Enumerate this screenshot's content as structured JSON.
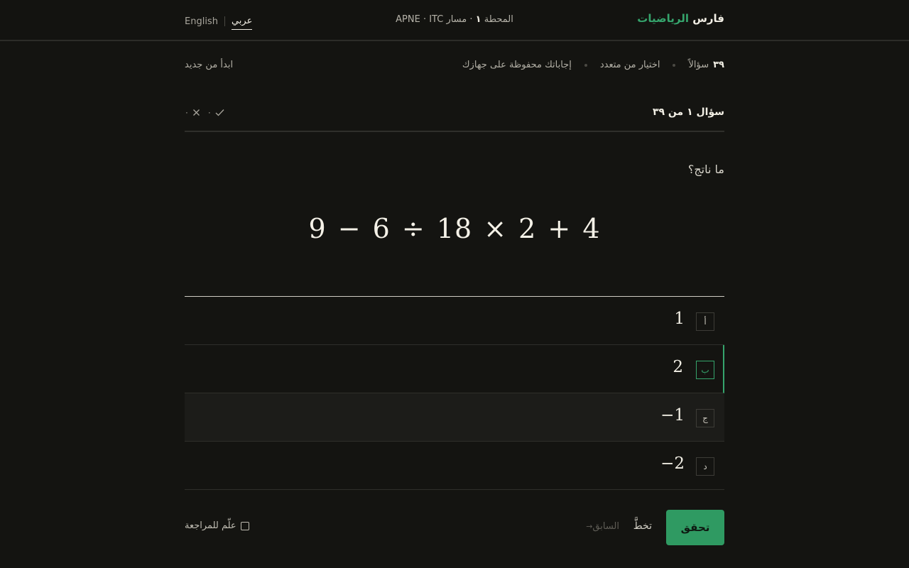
{
  "header": {
    "brand_text": "فارس ",
    "brand_accent": "الرياضيات",
    "station_label": "المحطة ",
    "station_number": "١",
    "station_track": " · مسار APNE · ITC",
    "lang_arabic": "عربي",
    "lang_english": "English"
  },
  "meta": {
    "question_count": "٣٩",
    "question_count_label": "سؤالاً",
    "question_type": "اختيار من متعدد",
    "saved_note": "إجاباتك محفوظة على جهازك",
    "restart_label": "ابدأ من جديد"
  },
  "question": {
    "progress_label": "سؤال ١ من ٣٩",
    "correct_icon": "check-icon",
    "correct_count": "٠",
    "wrong_icon": "x-icon",
    "wrong_count": "٠",
    "prompt": "ما ناتج؟",
    "expression": "9 − 6 ÷ 18 × 2 + 4"
  },
  "options": [
    {
      "letter": "أ",
      "value": "1"
    },
    {
      "letter": "ب",
      "value": "2"
    },
    {
      "letter": "ج",
      "value": "−1"
    },
    {
      "letter": "د",
      "value": "−2"
    }
  ],
  "footer": {
    "check_label": "تحقق",
    "skip_label": "تخطَّ",
    "prev_label": "السابق",
    "flag_label": "علّم للمراجعة"
  },
  "colors": {
    "accent": "#35a46c",
    "button": "#2f9a62",
    "background": "#141411"
  }
}
